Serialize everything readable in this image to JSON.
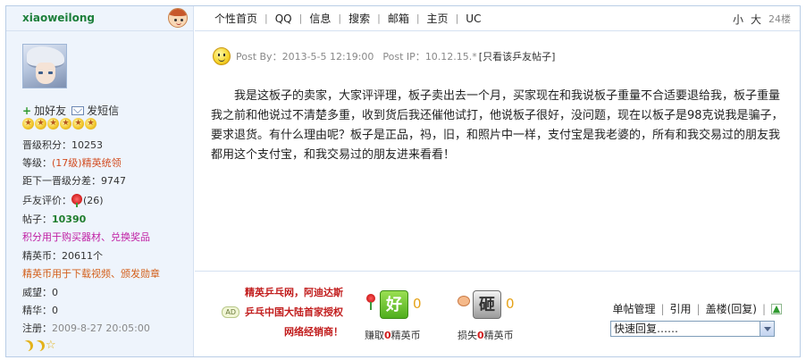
{
  "user": {
    "name": "xiaoweilong",
    "add_friend": "加好友",
    "send_message": "发短信",
    "stats": [
      {
        "label": "晋级积分：",
        "value": "10253"
      },
      {
        "label": "等级：",
        "value": "(17级)精英统领"
      },
      {
        "label": "距下一晋级分差：",
        "value": "9747"
      },
      {
        "label": "乒友评价：",
        "value": "(26)"
      },
      {
        "label": "帖子：",
        "value": "10390"
      },
      {
        "label": "",
        "value": "积分用于购买器材、兑换奖品"
      },
      {
        "label": "精英币：",
        "value": "20611个"
      },
      {
        "label": "",
        "value": "精英币用于下载视频、颁发勋章"
      },
      {
        "label": "威望：",
        "value": "0"
      },
      {
        "label": "精华：",
        "value": "0"
      },
      {
        "label": "注册：",
        "value": "2009-8-27 20:05:00"
      }
    ]
  },
  "nav": {
    "items": [
      "个性首页",
      "QQ",
      "信息",
      "搜索",
      "邮箱",
      "主页",
      "UC"
    ],
    "size_small": "小",
    "size_large": "大",
    "floor": "24楼"
  },
  "post": {
    "post_by_label": "Post By：",
    "post_time": "2013-5-5 12:19:00",
    "post_ip_label": "Post IP：",
    "post_ip": "10.12.15.*",
    "only_this_user": "[只看该乒友帖子]",
    "body": "我是这板子的卖家，大家评评理，板子卖出去一个月，买家现在和我说板子重量不合适要退给我，板子重量我之前和他说过不清楚多重，收到货后我还催他试打，他说板子很好，没问题，现在以板子是98克说我是骗子，要求退货。有什么理由呢？板子是正品，祃，旧，和照片中一样，支付宝是我老婆的，所有和我交易过的朋友我都用这个支付宝，和我交易过的朋友进来看看！"
  },
  "ad": {
    "line1": "精英乒乓网，阿迪达斯",
    "badge": "AD",
    "line2": "乒乓中国大陆首家授权",
    "line3": "网络经销商！"
  },
  "votes": {
    "good_badge": "好",
    "good_count": "0",
    "good_label_prefix": "赚取",
    "good_label_value": "0",
    "good_label_suffix": "精英币",
    "bad_badge": "砸",
    "bad_count": "0",
    "bad_label_prefix": "损失",
    "bad_label_value": "0",
    "bad_label_suffix": "精英币"
  },
  "manage": {
    "post_manage": "单帖管理",
    "quote": "引用",
    "reply_floor": "盖楼(回复)",
    "quick_reply": "快速回复……"
  }
}
